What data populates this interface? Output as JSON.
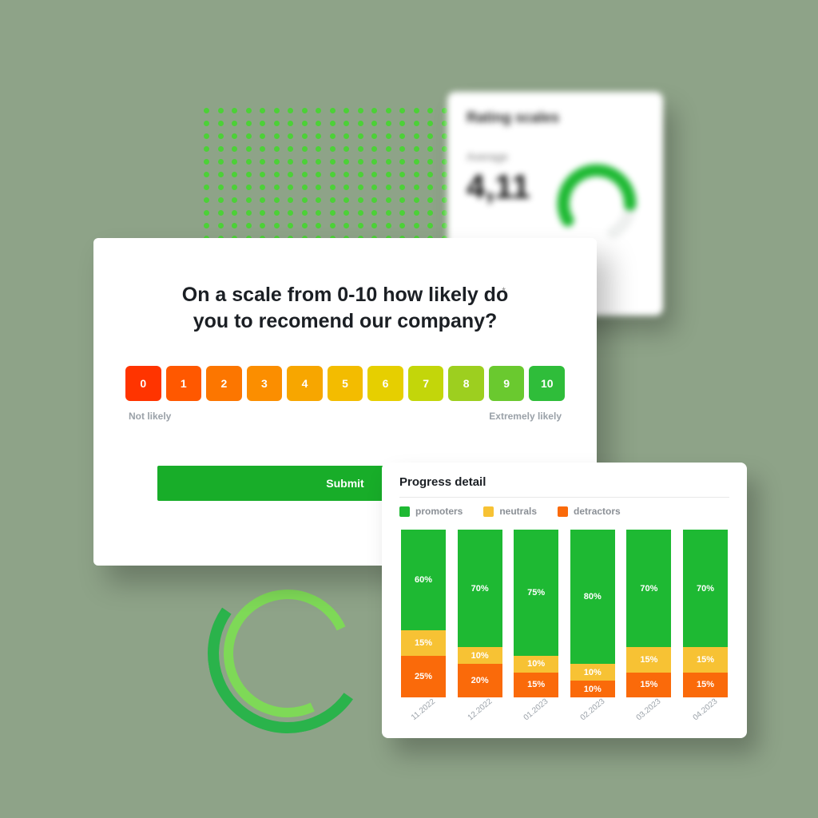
{
  "colors": {
    "promoter": "#1eb933",
    "neutral": "#f7c234",
    "detractor": "#fa6a0a",
    "scale": [
      "#ff3400",
      "#ff5800",
      "#fc7600",
      "#fb8e00",
      "#f7a600",
      "#f3bc00",
      "#e6cf00",
      "#c3d60a",
      "#9dcf1f",
      "#6ac92f",
      "#2fbd3a"
    ]
  },
  "rating_card": {
    "title": "Rating scales",
    "avg_label": "Average",
    "avg_value": "4,11"
  },
  "survey": {
    "question": "On a scale from 0-10 how likely do you to recomend our company?",
    "low_label": "Not likely",
    "high_label": "Extremely likely",
    "submit_label": "Submit",
    "options": [
      "0",
      "1",
      "2",
      "3",
      "4",
      "5",
      "6",
      "7",
      "8",
      "9",
      "10"
    ]
  },
  "progress": {
    "title": "Progress detail",
    "legend": {
      "promoters": "promoters",
      "neutrals": "neutrals",
      "detractors": "detractors"
    }
  },
  "chart_data": {
    "type": "bar",
    "stacked": true,
    "title": "Progress detail",
    "ylabel": "",
    "xlabel": "",
    "ylim": [
      0,
      100
    ],
    "legend_position": "top-left",
    "categories": [
      "11.2022",
      "12.2022",
      "01.2023",
      "02.2023",
      "03.2023",
      "04.2023"
    ],
    "series": [
      {
        "name": "promoters",
        "color": "#1eb933",
        "values": [
          60,
          70,
          75,
          80,
          70,
          70
        ]
      },
      {
        "name": "neutrals",
        "color": "#f7c234",
        "values": [
          15,
          10,
          10,
          10,
          15,
          15
        ]
      },
      {
        "name": "detractors",
        "color": "#fa6a0a",
        "values": [
          25,
          20,
          15,
          10,
          15,
          15
        ]
      }
    ]
  }
}
